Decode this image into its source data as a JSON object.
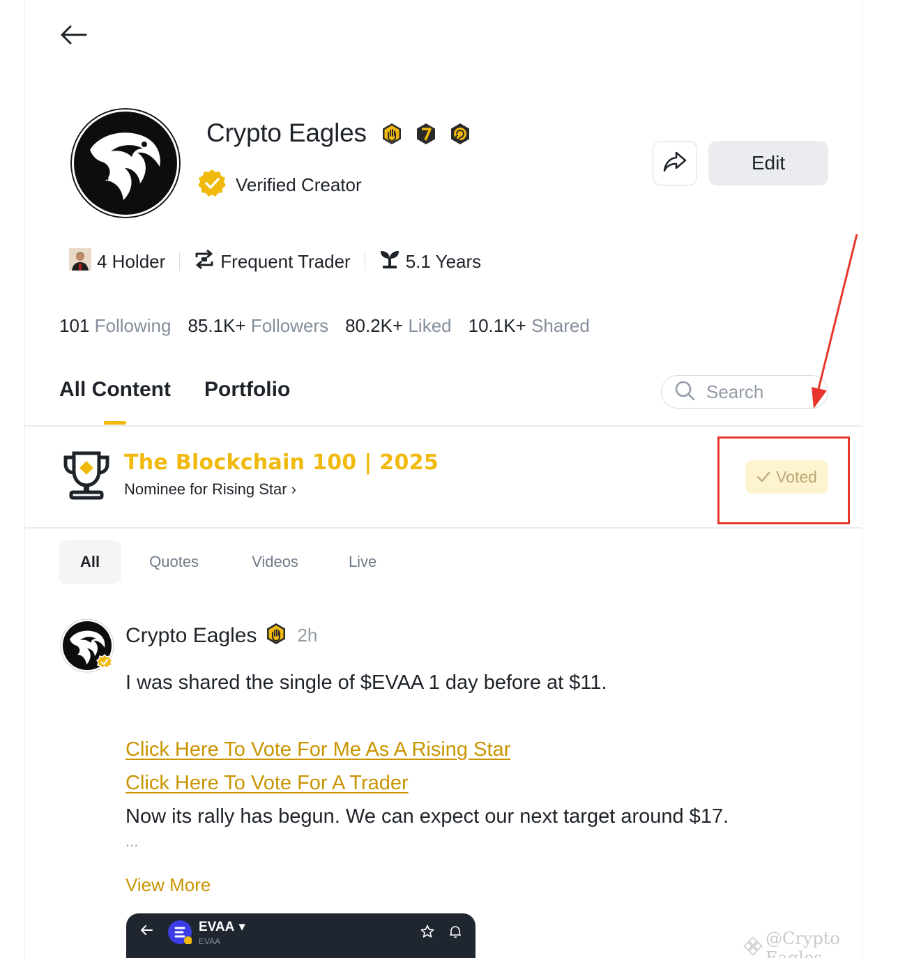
{
  "profile": {
    "name": "Crypto Eagles",
    "verified_label": "Verified Creator",
    "edit_label": "Edit"
  },
  "tags": [
    {
      "label": "4 Holder",
      "icon": "holder-avatar-icon"
    },
    {
      "label": "Frequent Trader",
      "icon": "trade-swap-icon"
    },
    {
      "label": "5.1 Years",
      "icon": "sprout-icon"
    }
  ],
  "stats": [
    {
      "num": "101",
      "label": "Following"
    },
    {
      "num": "85.1K+",
      "label": "Followers"
    },
    {
      "num": "80.2K+",
      "label": "Liked"
    },
    {
      "num": "10.1K+",
      "label": "Shared"
    }
  ],
  "tabs": [
    "All Content",
    "Portfolio"
  ],
  "search": {
    "placeholder": "Search"
  },
  "award": {
    "title": "The Blockchain 100 | 2025",
    "subtitle": "Nominee for Rising Star",
    "chevron": "›",
    "voted_label": "Voted"
  },
  "subtabs": [
    "All",
    "Quotes",
    "Videos",
    "Live"
  ],
  "post": {
    "author": "Crypto Eagles",
    "time": "2h",
    "line1": "I was shared the single of $EVAA 1 day before at $11.",
    "link1": "Click Here To Vote For Me As A Rising Star",
    "link2": "Click Here To Vote For A Trader",
    "line2": "Now its rally has begun. We can expect our next target around $17.",
    "ellipsis": "...",
    "view_more": "View More"
  },
  "embed": {
    "title": "EVAA",
    "subtitle": "EVAA"
  },
  "watermark": "@Crypto Eagles",
  "colors": {
    "accent": "#f0b90b",
    "link": "#c99400",
    "annotation": "#e8372a"
  }
}
